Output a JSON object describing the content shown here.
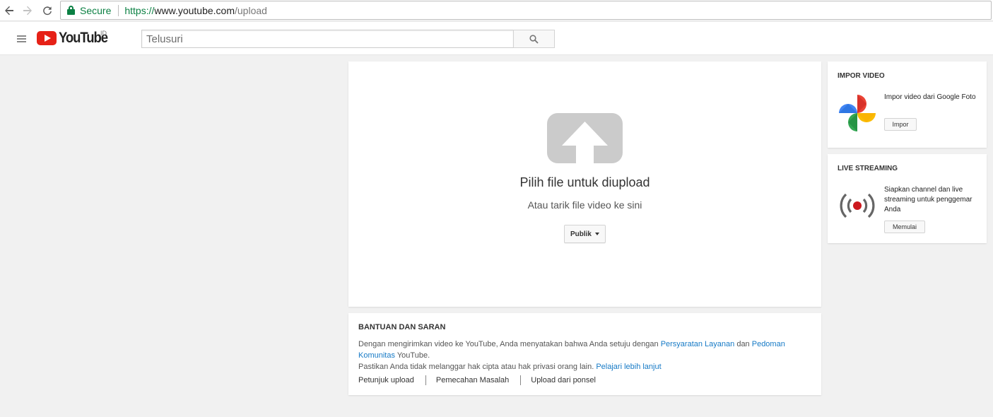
{
  "browser": {
    "nav": {
      "back": "back-arrow-icon",
      "forward": "forward-arrow-icon",
      "reload": "reload-icon"
    },
    "secure_label": "Secure",
    "url_scheme": "https://",
    "url_host": "www.youtube.com",
    "url_path": "/upload",
    "accent_color": "#0b8043"
  },
  "masthead": {
    "logo_text": "YouTube",
    "region": "ID",
    "search_placeholder": "Telusuri",
    "brand_color": "#e62117"
  },
  "upload": {
    "title": "Pilih file untuk diupload",
    "subtitle": "Atau tarik file video ke sini",
    "privacy_value": "Publik"
  },
  "help": {
    "title": "BANTUAN DAN SARAN",
    "line1_prefix": "Dengan mengirimkan video ke YouTube, Anda menyatakan bahwa Anda setuju dengan ",
    "terms_link": "Persyaratan Layanan",
    "line1_and": " dan ",
    "guidelines_link": "Pedoman Komunitas",
    "line1_suffix": " YouTube.",
    "line2_prefix": "Pastikan Anda tidak melanggar hak cipta atau hak privasi orang lain. ",
    "learn_more_link": "Pelajari lebih lanjut",
    "links": [
      "Petunjuk upload",
      "Pemecahan Masalah",
      "Upload dari ponsel"
    ],
    "link_color": "#167ac6"
  },
  "import_video": {
    "title": "IMPOR VIDEO",
    "description": "Impor video dari Google Foto",
    "button": "Impor"
  },
  "live_streaming": {
    "title": "LIVE STREAMING",
    "description": "Siapkan channel dan live streaming untuk penggemar Anda",
    "button": "Memulai"
  }
}
